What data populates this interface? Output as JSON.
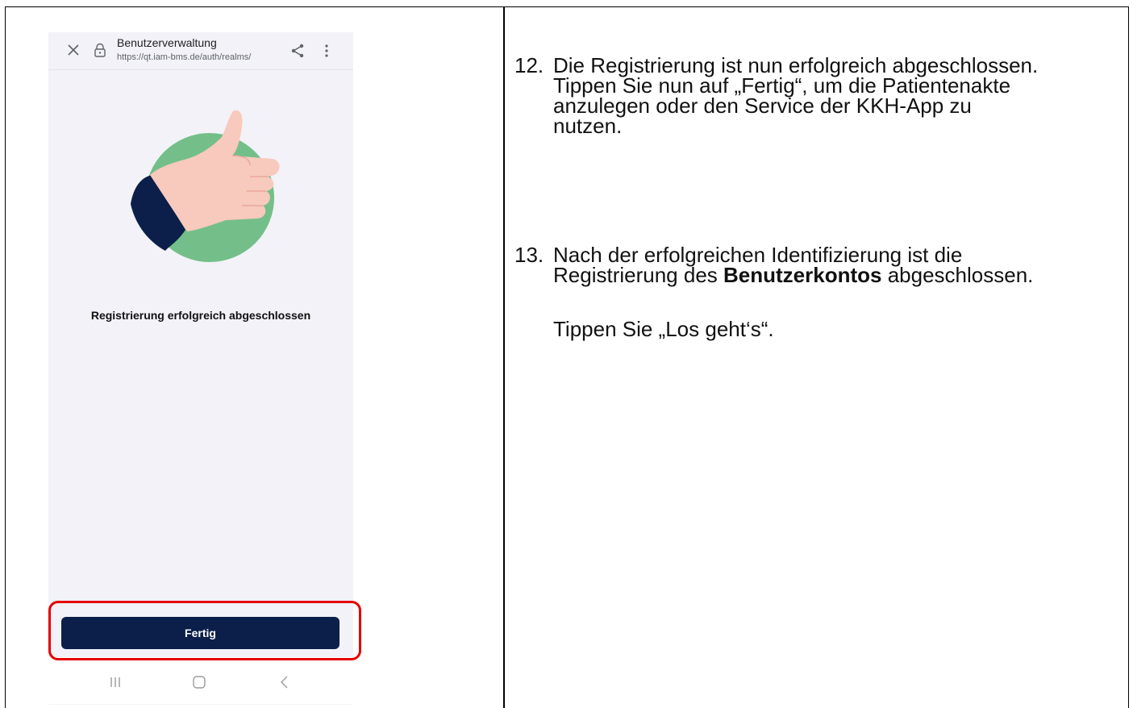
{
  "browser_bar": {
    "title": "Benutzerverwaltung",
    "url": "https://qt.iam-bms.de/auth/realms/"
  },
  "illustration": {
    "icon": "thumbs-up-icon",
    "colors": {
      "circle": "#74bf89",
      "skin": "#f8c9bd",
      "sleeve": "#0b1f4a"
    }
  },
  "success_message": "Registrierung erfolgreich abgeschlossen",
  "primary_button": {
    "label": "Fertig",
    "color": "#0b1f4a",
    "highlight": "#e60000"
  },
  "nav": {
    "icons": [
      "recent-apps-icon",
      "home-icon",
      "back-icon"
    ]
  },
  "instructions": {
    "step12": {
      "number": "12.",
      "lines": [
        "Die Registrierung ist nun erfolgreich abgeschlossen.",
        "Tippen Sie nun auf „Fertig“, um die Patientenakte",
        "anzulegen oder den Service der KKH-App zu",
        "nutzen."
      ]
    },
    "step13": {
      "number": "13.",
      "line1": "Nach der erfolgreichen Identifizierung ist die",
      "line2_before": "Registrierung des ",
      "line2_bold": "Benutzerkontos",
      "line2_after": " abgeschlossen.",
      "sub": "Tippen Sie „Los geht‘s“."
    }
  }
}
